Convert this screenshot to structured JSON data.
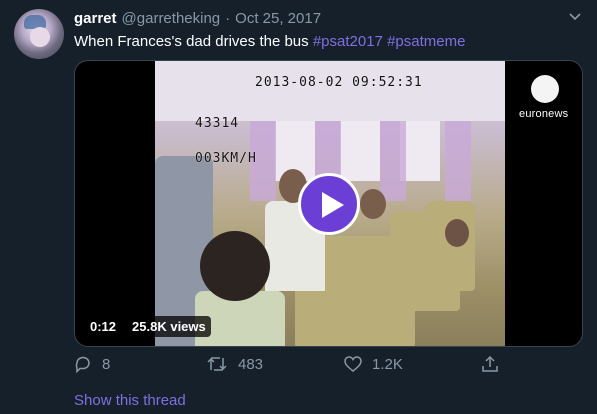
{
  "tweet": {
    "author_name": "garret",
    "handle": "@garretheking",
    "separator": "·",
    "date": "Oct 25, 2017",
    "text": "When Frances's dad drives the bus ",
    "hashtags": [
      "#psat2017",
      "#psatmeme"
    ]
  },
  "video": {
    "osd_timestamp": "2013-08-02 09:52:31",
    "osd_bus_number": "43314",
    "osd_speed": "003KM/H",
    "watermark": "euronews",
    "duration": "0:12",
    "views": "25.8K views"
  },
  "actions": {
    "reply_count": "8",
    "retweet_count": "483",
    "like_count": "1.2K"
  },
  "show_thread_label": "Show this thread",
  "icons": {
    "chevron": "chevron-down-icon",
    "reply": "reply-icon",
    "retweet": "retweet-icon",
    "like": "heart-icon",
    "share": "share-icon",
    "play": "play-icon"
  },
  "colors": {
    "background": "#15202b",
    "accent": "#7f6fe0",
    "muted": "#8899a6",
    "play_button": "#6b3fd6"
  }
}
